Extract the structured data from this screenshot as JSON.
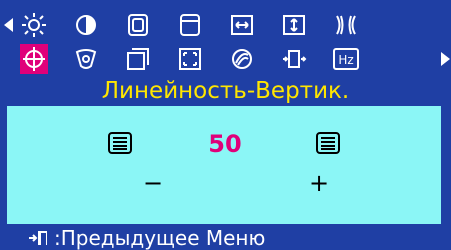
{
  "osd": {
    "title": "Линейность-Вертик.",
    "row1_icons": [
      "brightness-icon",
      "contrast-icon",
      "h-position-icon",
      "v-position-icon",
      "h-size-icon",
      "v-size-icon",
      "pincushion-icon"
    ],
    "row2_icons": [
      "v-linearity-icon",
      "trapezoid-icon",
      "h-linearity-icon",
      "zoom-icon",
      "degauss-icon",
      "input-icon",
      "frequency-icon"
    ],
    "selected_icon": "v-linearity-icon",
    "frequency_label": "Hz",
    "value": "50",
    "minus": "−",
    "plus": "+",
    "footer_text": ":Предыдущее Меню"
  },
  "colors": {
    "background": "#1f3fa4",
    "panel": "#8bf6f6",
    "title": "#ffe600",
    "accent": "#e0007a"
  }
}
